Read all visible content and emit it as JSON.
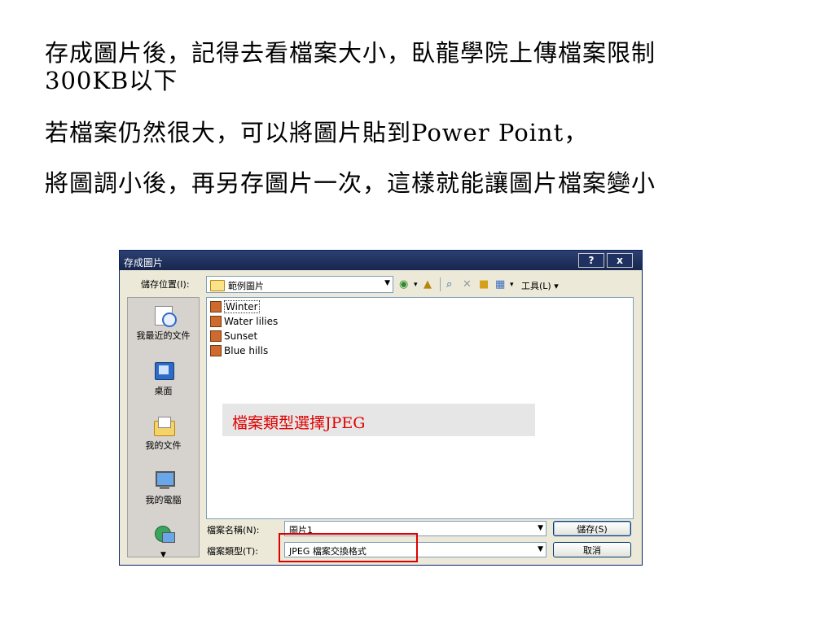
{
  "slide": {
    "line1": "存成圖片後，記得去看檔案大小，臥龍學院上傳檔案限制",
    "line2": "300KB以下",
    "line3": "若檔案仍然很大，可以將圖片貼到Power Point，",
    "line4": "將圖調小後，再另存圖片一次，這樣就能讓圖片檔案變小"
  },
  "dialog": {
    "title": "存成圖片",
    "help": "?",
    "close": "x",
    "save_in_label": "儲存位置(I):",
    "save_in_value": "範例圖片",
    "tools_label": "工具(L)",
    "places": [
      "我最近的文件",
      "桌面",
      "我的文件",
      "我的電腦"
    ],
    "files": [
      "Winter",
      "Water lilies",
      "Sunset",
      "Blue hills"
    ],
    "file_name_label": "檔案名稱(N):",
    "file_name_value": "圖片1",
    "file_type_label": "檔案類型(T):",
    "file_type_value": "JPEG 檔案交換格式",
    "save_button": "儲存(S)",
    "cancel_button": "取消"
  },
  "annotation": {
    "text": "檔案類型選擇JPEG",
    "color": "#e00000"
  }
}
